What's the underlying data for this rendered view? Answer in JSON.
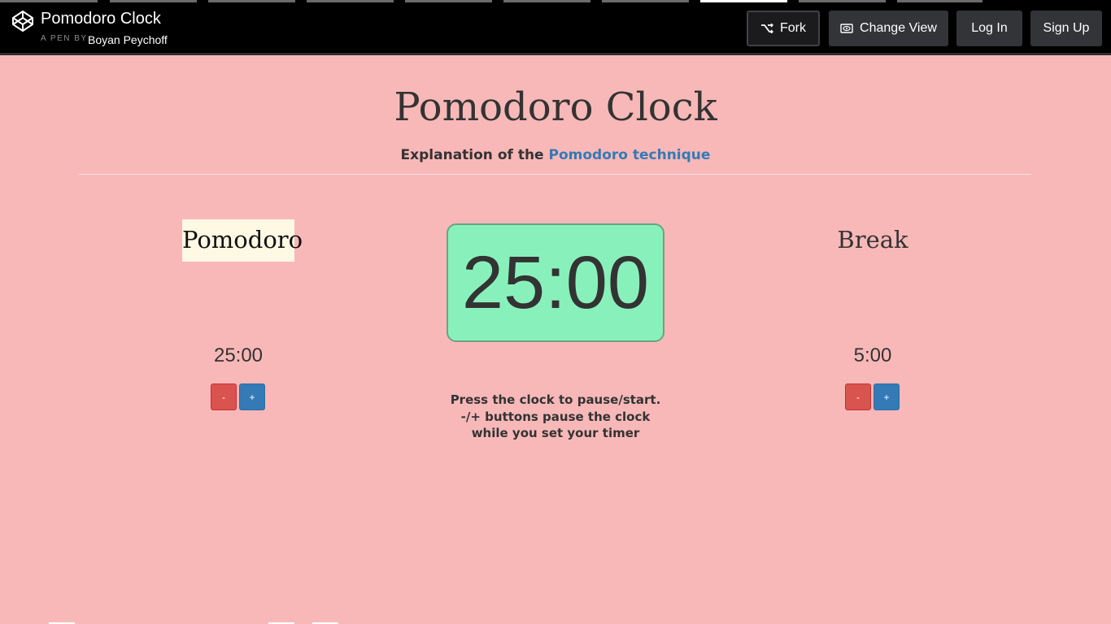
{
  "header": {
    "pen_title": "Pomodoro Clock",
    "pen_by": "A PEN BY",
    "author": "Boyan Peychoff",
    "fork_label": "Fork",
    "change_view_label": "Change View",
    "login_label": "Log In",
    "signup_label": "Sign Up"
  },
  "main": {
    "title": "Pomodoro Clock",
    "subtitle_prefix": "Explanation of the",
    "subtitle_link": "Pomodoro technique",
    "session_label": "Pomodoro",
    "break_label": "Break",
    "clock_value": "25:00",
    "session_length": "25:00",
    "break_length": "5:00",
    "minus_label": "-",
    "plus_label": "+",
    "instructions": {
      "line1": "Press the clock to pause/start.",
      "line2_strong": "-/+",
      "line2_rest": "buttons pause the clock",
      "line3": "while you set your timer"
    }
  },
  "colors": {
    "background": "#f9b8b8",
    "clock": "#88f1bb",
    "session_label_bg": "#fff9e4",
    "minus_button": "#d9534f",
    "plus_button": "#337ab7",
    "link": "#337ab7"
  },
  "icons": {
    "logo": "codepen-logo-icon",
    "fork": "fork-icon",
    "change_view": "eye-icon"
  }
}
